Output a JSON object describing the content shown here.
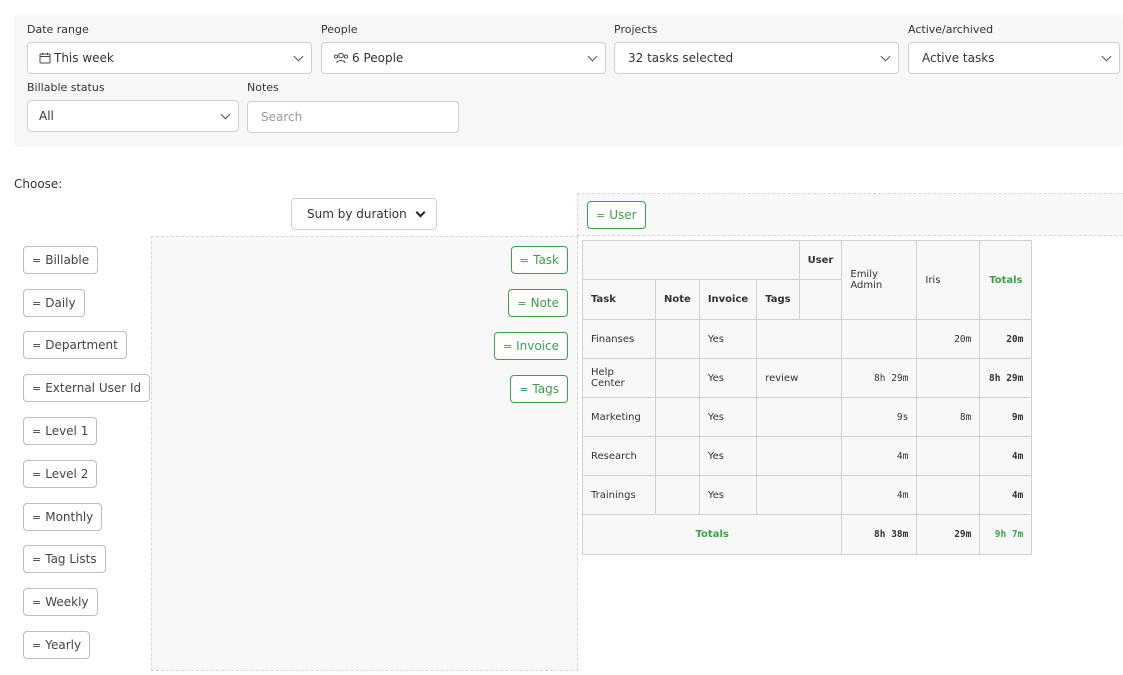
{
  "filters": {
    "date_range": {
      "label": "Date range",
      "value": "This week"
    },
    "people": {
      "label": "People",
      "value": "6 People"
    },
    "projects": {
      "label": "Projects",
      "value": "32 tasks selected"
    },
    "active_archived": {
      "label": "Active/archived",
      "value": "Active tasks"
    },
    "billable_status": {
      "label": "Billable status",
      "value": "All"
    },
    "notes": {
      "label": "Notes",
      "placeholder": "Search"
    }
  },
  "choose_label": "Choose:",
  "sum_select": {
    "value": "Sum by duration"
  },
  "available_fields": [
    "Billable",
    "Daily",
    "Department",
    "External User Id",
    "Level 1",
    "Level 2",
    "Monthly",
    "Tag Lists",
    "Weekly",
    "Yearly"
  ],
  "row_fields": [
    "Task",
    "Note",
    "Invoice",
    "Tags"
  ],
  "column_fields": [
    "User"
  ],
  "grip_glyph": "=",
  "accent_color": "#3aa04a",
  "table": {
    "user_header": "User",
    "row_headers": [
      "Task",
      "Note",
      "Invoice",
      "Tags"
    ],
    "user_columns": [
      "Emily Admin",
      "Iris"
    ],
    "totals_label": "Totals",
    "rows": [
      {
        "task": "Finanses",
        "note": "",
        "invoice": "Yes",
        "tags": "",
        "emily": "",
        "iris": "20m",
        "total": "20m"
      },
      {
        "task": "Help Center",
        "note": "",
        "invoice": "Yes",
        "tags": "review",
        "emily": "8h 29m",
        "iris": "",
        "total": "8h 29m"
      },
      {
        "task": "Marketing",
        "note": "",
        "invoice": "Yes",
        "tags": "",
        "emily": "9s",
        "iris": "8m",
        "total": "9m"
      },
      {
        "task": "Research",
        "note": "",
        "invoice": "Yes",
        "tags": "",
        "emily": "4m",
        "iris": "",
        "total": "4m"
      },
      {
        "task": "Trainings",
        "note": "",
        "invoice": "Yes",
        "tags": "",
        "emily": "4m",
        "iris": "",
        "total": "4m"
      }
    ],
    "totals_row": {
      "label": "Totals",
      "emily": "8h 38m",
      "iris": "29m",
      "total": "9h 7m"
    }
  }
}
